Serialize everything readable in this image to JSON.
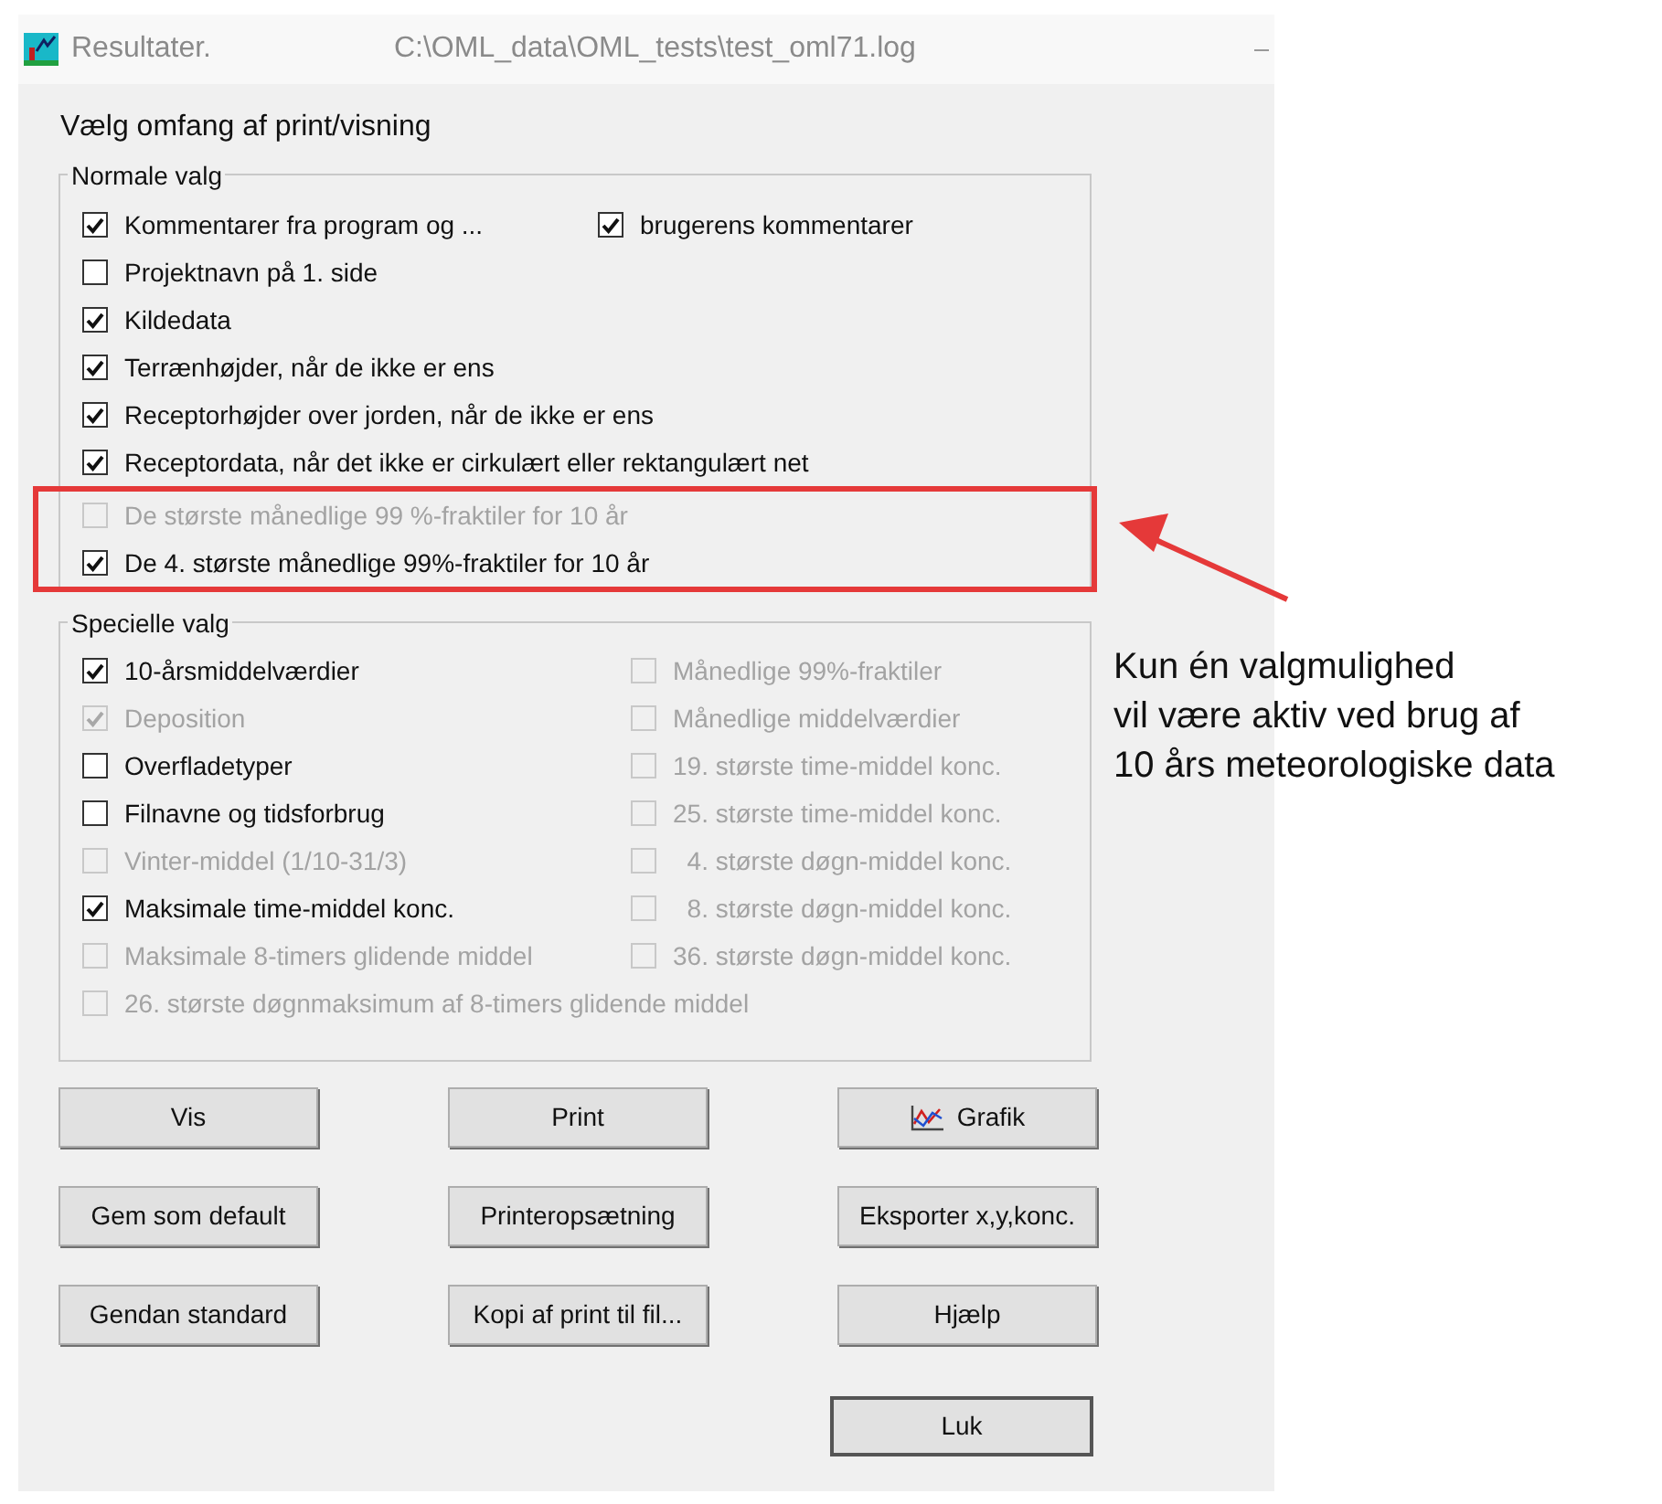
{
  "window": {
    "title": "Resultater.",
    "path": "C:\\OML_data\\OML_tests\\test_oml71.log"
  },
  "heading": "Vælg omfang af print/visning",
  "normal_group": {
    "label": "Normale valg",
    "rows": [
      {
        "highlighted": false,
        "items": [
          {
            "label": "Kommentarer fra program og ...",
            "checked": true,
            "disabled": false
          },
          {
            "label": "brugerens kommentarer",
            "checked": true,
            "disabled": false
          }
        ]
      },
      {
        "highlighted": false,
        "items": [
          {
            "label": "Projektnavn på 1. side",
            "checked": false,
            "disabled": false
          }
        ]
      },
      {
        "highlighted": false,
        "items": [
          {
            "label": "Kildedata",
            "checked": true,
            "disabled": false
          }
        ]
      },
      {
        "highlighted": false,
        "items": [
          {
            "label": "Terrænhøjder, når de ikke er ens",
            "checked": true,
            "disabled": false
          }
        ]
      },
      {
        "highlighted": false,
        "items": [
          {
            "label": "Receptorhøjder over jorden, når de ikke er ens",
            "checked": true,
            "disabled": false
          }
        ]
      },
      {
        "highlighted": false,
        "items": [
          {
            "label": "Receptordata, når det ikke er cirkulært eller rektangulært net",
            "checked": true,
            "disabled": false
          }
        ]
      },
      {
        "highlighted": true,
        "items": [
          {
            "label": "De største månedlige 99 %-fraktiler for 10 år",
            "checked": false,
            "disabled": true
          }
        ]
      },
      {
        "highlighted": true,
        "items": [
          {
            "label": "De 4. største månedlige 99%-fraktiler for 10 år",
            "checked": true,
            "disabled": false
          }
        ]
      }
    ]
  },
  "special_group": {
    "label": "Specielle valg",
    "rows": [
      {
        "items": [
          {
            "label": "10-årsmiddelværdier",
            "checked": true,
            "disabled": false
          },
          {
            "label": "Månedlige 99%-fraktiler",
            "checked": false,
            "disabled": true
          }
        ]
      },
      {
        "items": [
          {
            "label": "Deposition",
            "checked": true,
            "disabled": true
          },
          {
            "label": "Månedlige middelværdier",
            "checked": false,
            "disabled": true
          }
        ]
      },
      {
        "items": [
          {
            "label": "Overfladetyper",
            "checked": false,
            "disabled": false
          },
          {
            "label": "19. største time-middel konc.",
            "checked": false,
            "disabled": true
          }
        ]
      },
      {
        "items": [
          {
            "label": "Filnavne og tidsforbrug",
            "checked": false,
            "disabled": false
          },
          {
            "label": "25. største time-middel konc.",
            "checked": false,
            "disabled": true
          }
        ]
      },
      {
        "items": [
          {
            "label": "Vinter-middel (1/10-31/3)",
            "checked": false,
            "disabled": true
          },
          {
            "label": "  4. største døgn-middel konc.",
            "checked": false,
            "disabled": true
          }
        ]
      },
      {
        "items": [
          {
            "label": "Maksimale time-middel konc.",
            "checked": true,
            "disabled": false
          },
          {
            "label": "  8. største døgn-middel konc.",
            "checked": false,
            "disabled": true
          }
        ]
      },
      {
        "items": [
          {
            "label": "Maksimale 8-timers glidende middel",
            "checked": false,
            "disabled": true
          },
          {
            "label": "36. største døgn-middel konc.",
            "checked": false,
            "disabled": true
          }
        ]
      },
      {
        "items": [
          {
            "label": "26. største døgnmaksimum af 8-timers glidende middel",
            "checked": false,
            "disabled": true
          }
        ]
      }
    ]
  },
  "buttons": [
    {
      "label": "Vis",
      "kind": "plain"
    },
    {
      "label": "Print",
      "kind": "plain"
    },
    {
      "label": "Grafik",
      "kind": "chart"
    },
    {
      "label": "Gem som default",
      "kind": "plain"
    },
    {
      "label": "Printeropsætning",
      "kind": "plain"
    },
    {
      "label": "Eksporter x,y,konc.",
      "kind": "plain"
    },
    {
      "label": "Gendan standard",
      "kind": "plain"
    },
    {
      "label": "Kopi af print til fil...",
      "kind": "plain"
    },
    {
      "label": "Hjælp",
      "kind": "plain"
    }
  ],
  "close_button": {
    "label": "Luk"
  },
  "annotation": {
    "lines": [
      "Kun én valgmulighed",
      "vil være aktiv ved brug af",
      "10 års meteorologiske data"
    ]
  }
}
